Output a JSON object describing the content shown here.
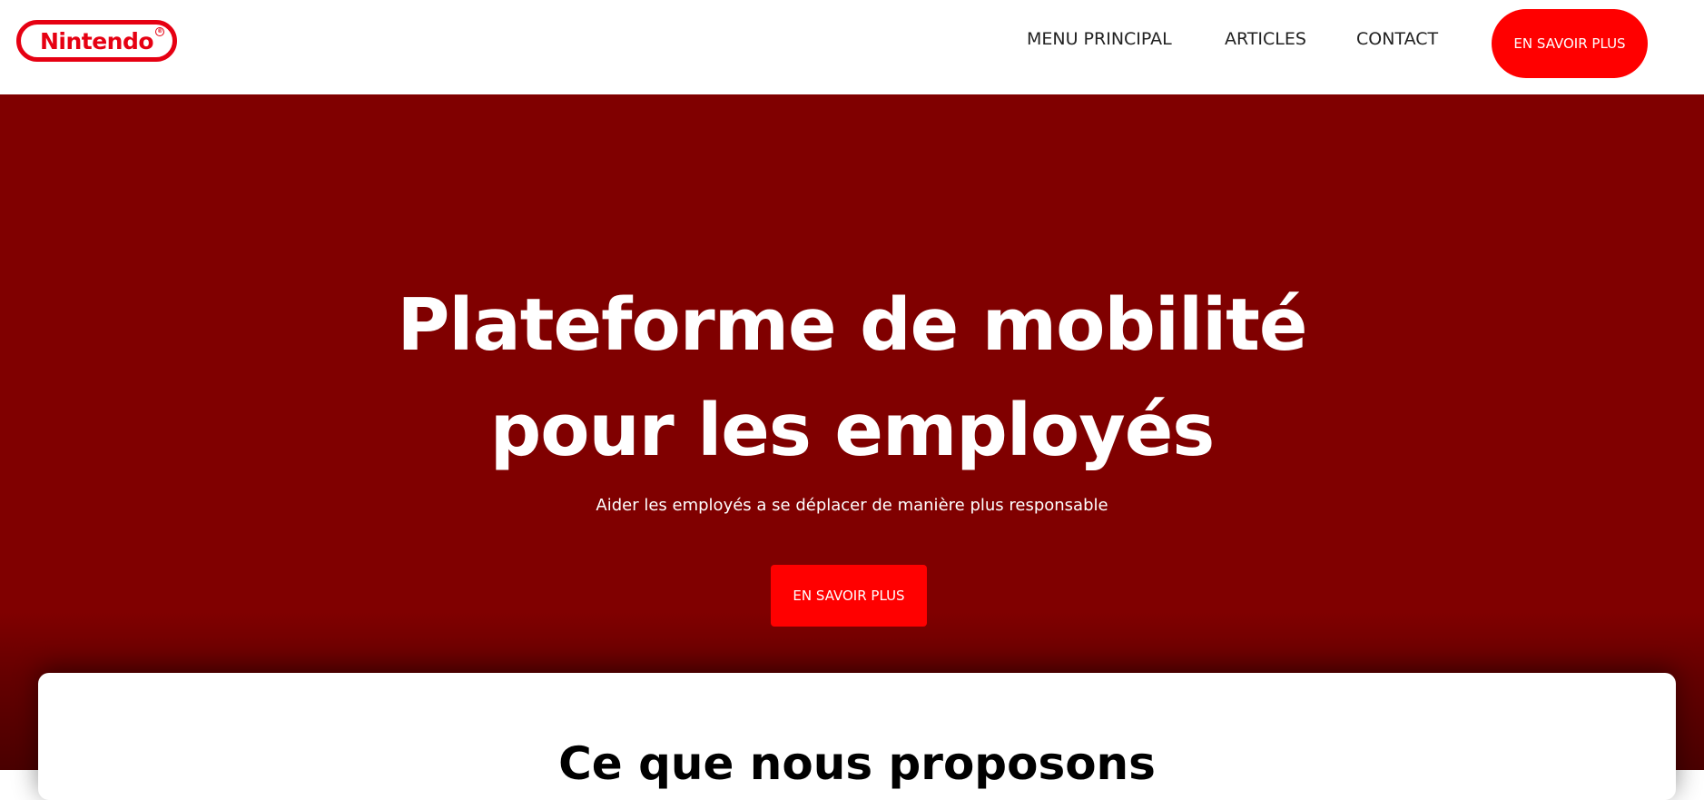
{
  "header": {
    "logo_text": "Nintendo",
    "logo_registered": "®",
    "nav": [
      {
        "label": "MENU PRINCIPAL"
      },
      {
        "label": "ARTICLES"
      },
      {
        "label": "CONTACT"
      }
    ],
    "cta_label": "EN SAVOIR PLUS"
  },
  "hero": {
    "title_line1": "Plateforme de mobilité",
    "title_line2": "pour les employés",
    "subtitle": "Aider les employés a se déplacer de manière plus responsable",
    "cta_label": "EN SAVOIR PLUS"
  },
  "section": {
    "title": "Ce que nous proposons"
  },
  "colors": {
    "brand_red": "#e60012",
    "cta_red": "#ff0000",
    "hero_bg": "#800000",
    "header_bg": "#ffffff"
  },
  "icons": {
    "logo": "nintendo-logo"
  }
}
